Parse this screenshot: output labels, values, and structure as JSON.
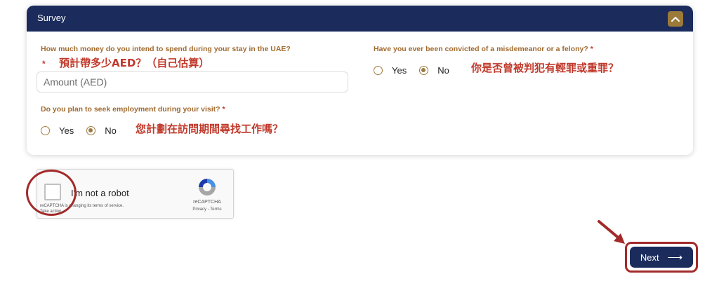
{
  "card": {
    "title": "Survey"
  },
  "questions": {
    "spend": {
      "label": "How much money do you intend to spend during your stay in the UAE?",
      "required_mark": "*",
      "note": "預計帶多少AED？（自己估算）",
      "placeholder": "Amount (AED)",
      "value": ""
    },
    "convicted": {
      "label": "Have you ever been convicted of a misdemeanor or a felony?",
      "required_mark": "*",
      "options": [
        "Yes",
        "No"
      ],
      "selected": "No",
      "note": "你是否曾被判犯有輕罪或重罪？"
    },
    "employment": {
      "label": "Do you plan to seek employment during your visit?",
      "required_mark": "*",
      "options": [
        "Yes",
        "No"
      ],
      "selected": "No",
      "note": "您計劃在訪問期間尋找工作嗎？"
    }
  },
  "recaptcha": {
    "label": "I'm not a robot",
    "notice_line1": "reCAPTCHA is changing its terms of service.",
    "notice_line2": "Take action.",
    "brand": "reCAPTCHA",
    "links": "Privacy - Terms",
    "checked": false
  },
  "footer": {
    "next_label": "Next",
    "next_arrow": "⟶"
  },
  "colors": {
    "header": "#1a2b5c",
    "accent": "#9c7a39",
    "label": "#a16a2e",
    "annotation": "#a32a2a"
  },
  "icons": {
    "collapse": "chevron-up-icon",
    "recaptcha": "recaptcha-logo-icon",
    "annotation": "red-arrow-icon"
  }
}
